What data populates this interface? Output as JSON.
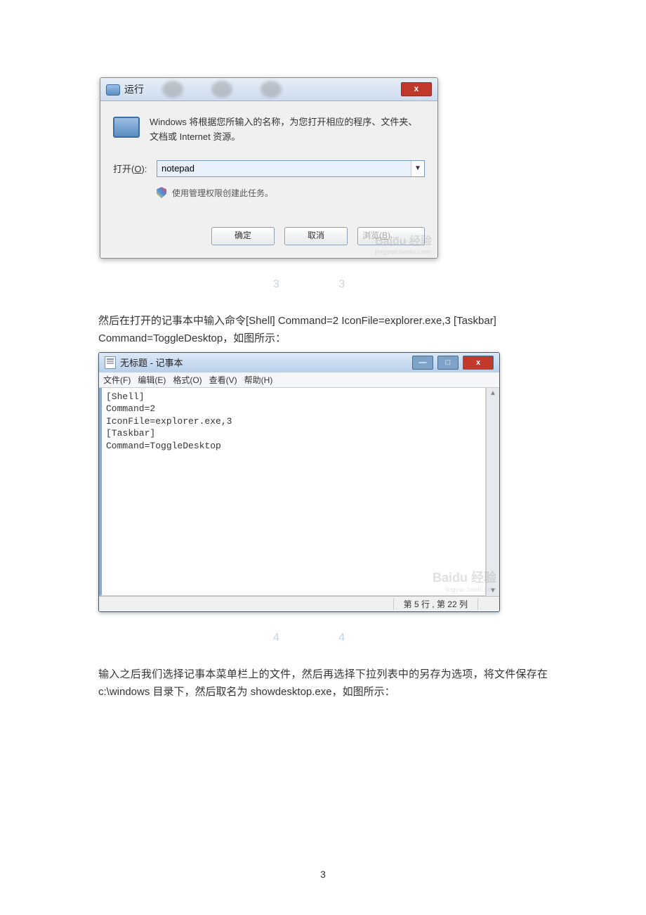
{
  "run_dialog": {
    "title": "运行",
    "desc": "Windows 将根据您所输入的名称，为您打开相应的程序、文件夹、文档或 Internet 资源。",
    "open_label_prefix": "打开(",
    "open_label_key": "O",
    "open_label_suffix": "):",
    "value": "notepad",
    "admin_text": "使用管理权限创建此任务。",
    "ok": "确定",
    "cancel": "取消",
    "browse_prefix": "浏览(",
    "browse_key": "B",
    "browse_suffix": ")...",
    "close_x": "x",
    "watermark_big": "Baidu 经验",
    "watermark_small": "jingyan.baidu.com"
  },
  "step3_marker": "3 3",
  "para1": "然后在打开的记事本中输入命令[Shell] Command=2 IconFile=explorer.exe,3 [Taskbar] Command=ToggleDesktop，如图所示：",
  "notepad": {
    "title": "无标题 - 记事本",
    "menu": {
      "file": "文件(F)",
      "edit": "编辑(E)",
      "format": "格式(O)",
      "view": "查看(V)",
      "help": "帮助(H)"
    },
    "content": "[Shell]\nCommand=2\nIconFile=explorer.exe,3\n[Taskbar]\nCommand=ToggleDesktop",
    "status": "第 5 行 , 第 22 列",
    "watermark_big": "Baidu 经验",
    "watermark_small": "jingyan.baidu.com",
    "min": "—",
    "max": "□",
    "close": "x"
  },
  "step4_marker": "4 4",
  "para2": "输入之后我们选择记事本菜单栏上的文件，然后再选择下拉列表中的另存为选项，将文件保存在 c:\\windows 目录下，然后取名为 showdesktop.exe，如图所示：",
  "page_number": "3"
}
